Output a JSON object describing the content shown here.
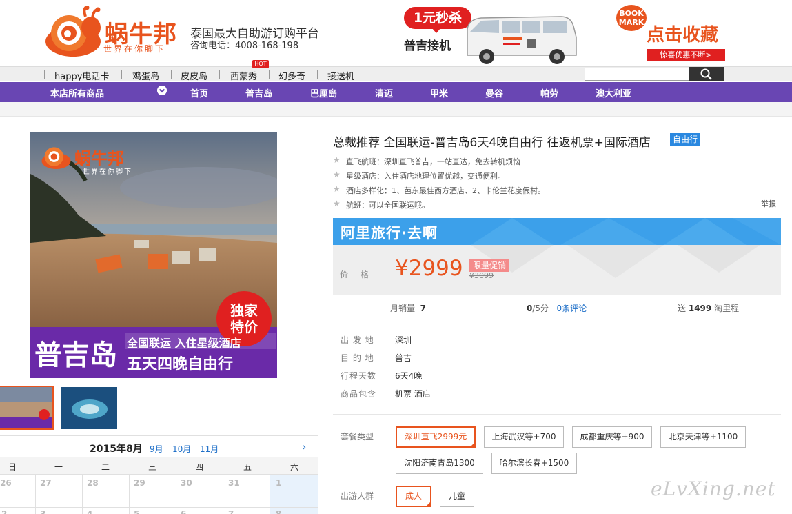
{
  "header": {
    "logo_text": "蜗牛邦",
    "logo_sub": "世界在你脚下",
    "tagline": "泰国最大自助游订购平台",
    "hotline": "咨询电话：4008-168-198",
    "ad_flash": "1元秒杀",
    "ad_pickup": "普吉接机",
    "bookmark_badge": "BOOK MARK",
    "bookmark_title": "点击收藏",
    "bookmark_sub": "惊喜优惠不断>"
  },
  "topnav": {
    "items": [
      "happy电话卡",
      "鸡蛋岛",
      "皮皮岛",
      "西蒙秀",
      "幻多奇",
      "接送机"
    ],
    "hot_badge": "HOT",
    "search_placeholder": ""
  },
  "mainnav": {
    "store_all": "本店所有商品",
    "items": [
      "首页",
      "普吉岛",
      "巴厘岛",
      "清迈",
      "甲米",
      "曼谷",
      "帕劳",
      "澳大利亚"
    ]
  },
  "poster": {
    "logo_text": "蜗牛邦",
    "logo_sub": "世界在你脚下",
    "badge_line1": "独家",
    "badge_line2": "特价",
    "big_title": "普吉岛",
    "line1": "全国联运 入住星级酒店",
    "line2": "五天四晚自由行"
  },
  "calendar": {
    "month": "2015年8月",
    "links": [
      "9月",
      "10月",
      "11月"
    ],
    "next": "›",
    "weekdays": [
      "日",
      "一",
      "二",
      "三",
      "四",
      "五",
      "六"
    ],
    "days_row1": [
      "26",
      "27",
      "28",
      "29",
      "30",
      "31",
      "1"
    ],
    "days_row2": [
      "2",
      "3",
      "4",
      "5",
      "6",
      "7",
      "8"
    ]
  },
  "product": {
    "title": "总裁推荐 全国联运-普吉岛6天4晚自由行 往返机票+国际酒店",
    "type_tag": "自由行",
    "features": [
      "直飞航班：深圳直飞普吉，一站直达，免去转机烦恼",
      "星级酒店：入住酒店地理位置优越，交通便利。",
      "酒店多样化：1、芭东最佳西方酒店、2、卡伦兰花度假村。",
      "航班：可以全国联运哦。"
    ],
    "report": "举报",
    "ali_banner": "阿里旅行·去啊",
    "price_label": "价格",
    "price": "¥2999",
    "promo_tag": "限量促销",
    "old_price": "¥3099",
    "stats": {
      "monthly_sales_label": "月销量",
      "monthly_sales": "7",
      "rating": "0",
      "rating_suffix": "/5分",
      "reviews": "0条评论",
      "points_prefix": "送",
      "points": "1499",
      "points_suffix": "淘里程"
    },
    "info": [
      {
        "label": "出 发 地",
        "value": "深圳"
      },
      {
        "label": "目 的 地",
        "value": "普吉"
      },
      {
        "label": "行程天数",
        "value": "6天4晚"
      },
      {
        "label": "商品包含",
        "value": "机票 酒店"
      }
    ],
    "package_label": "套餐类型",
    "packages": [
      "深圳直飞2999元",
      "上海武汉等+700",
      "成都重庆等+900",
      "北京天津等+1100",
      "沈阳济南青岛1300",
      "哈尔滨长春+1500"
    ],
    "traveler_label": "出游人群",
    "travelers": [
      "成人",
      "儿童"
    ]
  },
  "watermark": "eLvXing.net",
  "colors": {
    "brand_orange": "#e8541e",
    "nav_purple": "#6946b3",
    "ali_blue": "#3ca0ea",
    "link_blue": "#1e6fc8"
  }
}
